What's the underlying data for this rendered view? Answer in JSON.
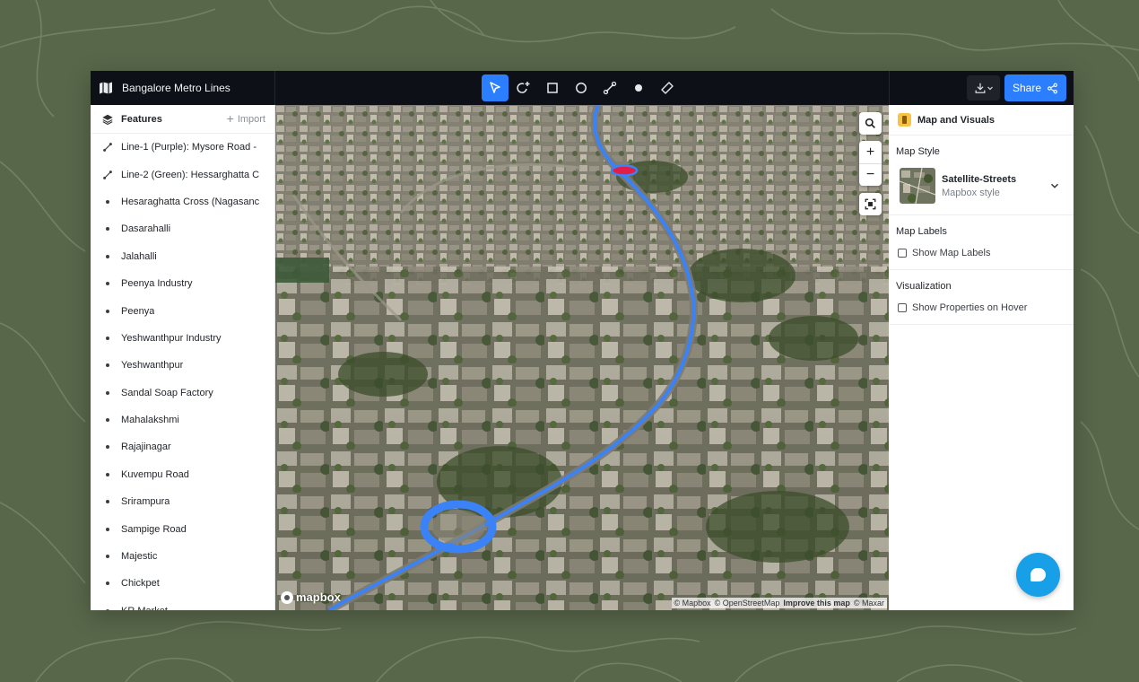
{
  "app": {
    "title": "Bangalore Metro Lines"
  },
  "toolbar": {
    "tools": [
      {
        "name": "select-tool",
        "icon": "cursor-arrow-icon",
        "active": true
      },
      {
        "name": "lasso-tool",
        "icon": "lasso-plus-icon",
        "active": false
      },
      {
        "name": "rectangle-tool",
        "icon": "square-icon",
        "active": false
      },
      {
        "name": "circle-tool",
        "icon": "circle-icon",
        "active": false
      },
      {
        "name": "line-tool",
        "icon": "line-segment-icon",
        "active": false
      },
      {
        "name": "point-tool",
        "icon": "dot-icon",
        "active": false
      },
      {
        "name": "measure-tool",
        "icon": "ruler-icon",
        "active": false
      }
    ],
    "share_label": "Share"
  },
  "features_panel": {
    "title": "Features",
    "import_label": "Import",
    "items": [
      {
        "label": "Line-1 (Purple): Mysore Road - ",
        "type": "line"
      },
      {
        "label": "Line-2 (Green): Hessarghatta C",
        "type": "line"
      },
      {
        "label": "Hesaraghatta Cross (Nagasanc",
        "type": "point"
      },
      {
        "label": "Dasarahalli",
        "type": "point"
      },
      {
        "label": "Jalahalli",
        "type": "point"
      },
      {
        "label": "Peenya Industry",
        "type": "point"
      },
      {
        "label": "Peenya",
        "type": "point"
      },
      {
        "label": "Yeshwanthpur Industry",
        "type": "point"
      },
      {
        "label": "Yeshwanthpur",
        "type": "point"
      },
      {
        "label": "Sandal Soap Factory",
        "type": "point"
      },
      {
        "label": "Mahalakshmi",
        "type": "point"
      },
      {
        "label": "Rajajinagar",
        "type": "point"
      },
      {
        "label": "Kuvempu Road",
        "type": "point"
      },
      {
        "label": "Srirampura",
        "type": "point"
      },
      {
        "label": "Sampige Road",
        "type": "point"
      },
      {
        "label": "Majestic",
        "type": "point"
      },
      {
        "label": "Chickpet",
        "type": "point"
      },
      {
        "label": "KR Market",
        "type": "point"
      }
    ]
  },
  "map": {
    "logo_text": "mapbox",
    "attribution": {
      "mapbox": "© Mapbox",
      "osm": "© OpenStreetMap",
      "improve": "Improve this map",
      "maxar": "© Maxar"
    },
    "controls": {
      "zoom_in": "+",
      "zoom_out": "−"
    },
    "colors": {
      "route": "#3b82f6",
      "selected_marker": "#e11d48"
    }
  },
  "visuals_panel": {
    "title": "Map and Visuals",
    "map_style": {
      "section_title": "Map Style",
      "name": "Satellite-Streets",
      "subtitle": "Mapbox style"
    },
    "map_labels": {
      "section_title": "Map Labels",
      "checkbox_label": "Show Map Labels",
      "checked": false
    },
    "visualization": {
      "section_title": "Visualization",
      "checkbox_label": "Show Properties on Hover",
      "checked": false
    }
  },
  "theme": {
    "accent": "#2b7fff",
    "topbar_bg": "#0d1117",
    "chat_bubble": "#179fe8"
  }
}
